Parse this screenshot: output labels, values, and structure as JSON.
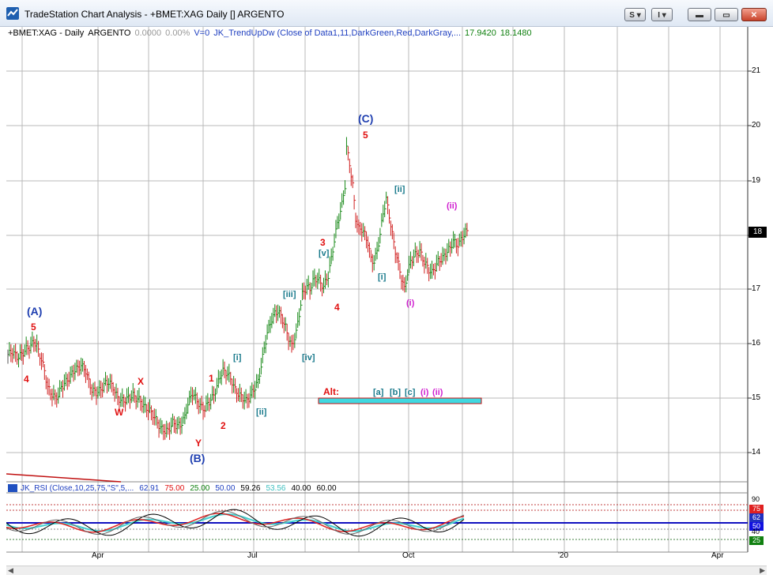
{
  "window": {
    "title": "TradeStation Chart Analysis - +BMET:XAG Daily [] ARGENTO",
    "buttons": {
      "s": "S",
      "i": "I"
    }
  },
  "infoline": {
    "symbol": "+BMET:XAG - Daily",
    "desc": "ARGENTO",
    "change": "0.0000",
    "pct": "0.00%",
    "volume": "V=0",
    "indicator": "JK_TrendUpDw (Close of Data1,11,DarkGreen,Red,DarkGray,...",
    "v1": "17.9420",
    "v2": "18.1480"
  },
  "price_axis": {
    "labels": [
      "21",
      "20",
      "19",
      "18",
      "17",
      "16",
      "15",
      "14"
    ],
    "current": "18"
  },
  "rsi": {
    "label": "JK_RSI (Close,10,25,75,\"S\",5,...",
    "v1": "62.91",
    "v2": "75.00",
    "v3": "25.00",
    "v4": "50.00",
    "v5": "59.26",
    "v6": "53.56",
    "v7": "40.00",
    "v8": "60.00",
    "axis": [
      "90",
      "75",
      "62",
      "50",
      "40",
      "25"
    ],
    "box_colors": {
      "75": "#e02020",
      "62": "#2030c0",
      "50": "#1010e0",
      "25": "#108010"
    }
  },
  "dates": [
    "Apr",
    "Jul",
    "Oct",
    "'20",
    "Apr"
  ],
  "waves": {
    "A": "(A)",
    "A5": "5",
    "A4": "4",
    "W": "W",
    "X": "X",
    "Y": "Y",
    "B": "(B)",
    "w1": "1",
    "w2": "2",
    "w3": "3",
    "w4": "4",
    "C": "(C)",
    "C5": "5",
    "i1": "[i]",
    "ii1": "[ii]",
    "iii": "[iii]",
    "iv": "[iv]",
    "v": "[v]",
    "i2": "[i]",
    "ii2": "[ii]",
    "pi": "(i)",
    "pii": "(ii)",
    "alt": "Alt:",
    "alt_a": "[a]",
    "alt_b": "[b]",
    "alt_c": "[c]",
    "alt_i": "(i)",
    "alt_ii": "(ii)"
  },
  "chart_data": {
    "type": "bar",
    "title": "+BMET:XAG - Daily",
    "ylim": [
      13.5,
      22.2
    ],
    "x_ticks": [
      "Apr",
      "Jul",
      "Oct",
      "'20",
      "Apr"
    ],
    "close_path": [
      [
        0,
        15.8
      ],
      [
        3,
        15.85
      ],
      [
        6,
        15.75
      ],
      [
        9,
        15.8
      ],
      [
        12,
        15.9
      ],
      [
        15,
        15.95
      ],
      [
        17,
        16.05
      ],
      [
        19,
        15.95
      ],
      [
        22,
        15.7
      ],
      [
        24,
        15.5
      ],
      [
        26,
        15.2
      ],
      [
        28,
        15.1
      ],
      [
        31,
        15.0
      ],
      [
        33,
        15.05
      ],
      [
        35,
        15.2
      ],
      [
        38,
        15.3
      ],
      [
        41,
        15.4
      ],
      [
        43,
        15.5
      ],
      [
        46,
        15.55
      ],
      [
        48,
        15.6
      ],
      [
        51,
        15.5
      ],
      [
        53,
        15.3
      ],
      [
        55,
        15.15
      ],
      [
        58,
        15.1
      ],
      [
        61,
        15.15
      ],
      [
        63,
        15.25
      ],
      [
        66,
        15.3
      ],
      [
        69,
        15.2
      ],
      [
        71,
        15.05
      ],
      [
        74,
        14.95
      ],
      [
        76,
        14.95
      ],
      [
        79,
        15.0
      ],
      [
        82,
        15.05
      ],
      [
        84,
        15.0
      ],
      [
        87,
        14.95
      ],
      [
        89,
        14.85
      ],
      [
        92,
        14.8
      ],
      [
        95,
        14.7
      ],
      [
        97,
        14.6
      ],
      [
        100,
        14.45
      ],
      [
        103,
        14.4
      ],
      [
        105,
        14.4
      ],
      [
        108,
        14.55
      ],
      [
        110,
        14.5
      ],
      [
        113,
        14.5
      ],
      [
        116,
        14.65
      ],
      [
        118,
        14.9
      ],
      [
        121,
        15.1
      ],
      [
        123,
        15.0
      ],
      [
        126,
        14.85
      ],
      [
        129,
        14.8
      ],
      [
        131,
        14.9
      ],
      [
        134,
        15.0
      ],
      [
        137,
        15.2
      ],
      [
        139,
        15.4
      ],
      [
        141,
        15.5
      ],
      [
        144,
        15.45
      ],
      [
        147,
        15.3
      ],
      [
        149,
        15.15
      ],
      [
        152,
        15.05
      ],
      [
        154,
        15.0
      ],
      [
        156,
        14.95
      ],
      [
        158,
        15.0
      ],
      [
        161,
        15.15
      ],
      [
        164,
        15.3
      ],
      [
        166,
        15.6
      ],
      [
        168,
        15.9
      ],
      [
        170,
        16.2
      ],
      [
        173,
        16.45
      ],
      [
        175,
        16.55
      ],
      [
        177,
        16.6
      ],
      [
        179,
        16.5
      ],
      [
        182,
        16.3
      ],
      [
        184,
        16.1
      ],
      [
        186,
        15.95
      ],
      [
        189,
        16.2
      ],
      [
        191,
        16.55
      ],
      [
        193,
        16.9
      ],
      [
        196,
        17.05
      ],
      [
        198,
        17.0
      ],
      [
        200,
        17.15
      ],
      [
        203,
        17.2
      ],
      [
        205,
        17.1
      ],
      [
        207,
        17.05
      ],
      [
        210,
        17.25
      ],
      [
        212,
        17.55
      ],
      [
        214,
        17.9
      ],
      [
        216,
        18.2
      ],
      [
        219,
        18.55
      ],
      [
        221,
        18.9
      ],
      [
        222,
        19.6
      ],
      [
        224,
        19.3
      ],
      [
        226,
        18.9
      ],
      [
        228,
        18.3
      ],
      [
        230,
        18.1
      ],
      [
        232,
        18.1
      ],
      [
        234,
        18.0
      ],
      [
        236,
        17.85
      ],
      [
        238,
        17.55
      ],
      [
        240,
        17.5
      ],
      [
        242,
        17.7
      ],
      [
        244,
        18.0
      ],
      [
        246,
        18.4
      ],
      [
        248,
        18.65
      ],
      [
        250,
        18.35
      ],
      [
        252,
        18.0
      ],
      [
        254,
        17.7
      ],
      [
        256,
        17.45
      ],
      [
        258,
        17.2
      ],
      [
        260,
        17.0
      ],
      [
        262,
        17.3
      ],
      [
        264,
        17.5
      ],
      [
        266,
        17.6
      ],
      [
        268,
        17.65
      ],
      [
        270,
        17.7
      ],
      [
        272,
        17.55
      ],
      [
        274,
        17.45
      ],
      [
        276,
        17.35
      ],
      [
        278,
        17.3
      ],
      [
        280,
        17.4
      ],
      [
        282,
        17.5
      ],
      [
        284,
        17.55
      ],
      [
        286,
        17.6
      ],
      [
        288,
        17.7
      ],
      [
        290,
        17.75
      ],
      [
        292,
        17.9
      ],
      [
        294,
        17.8
      ],
      [
        296,
        17.85
      ],
      [
        298,
        17.95
      ],
      [
        300,
        18.05
      ],
      [
        302,
        18.05
      ]
    ]
  }
}
